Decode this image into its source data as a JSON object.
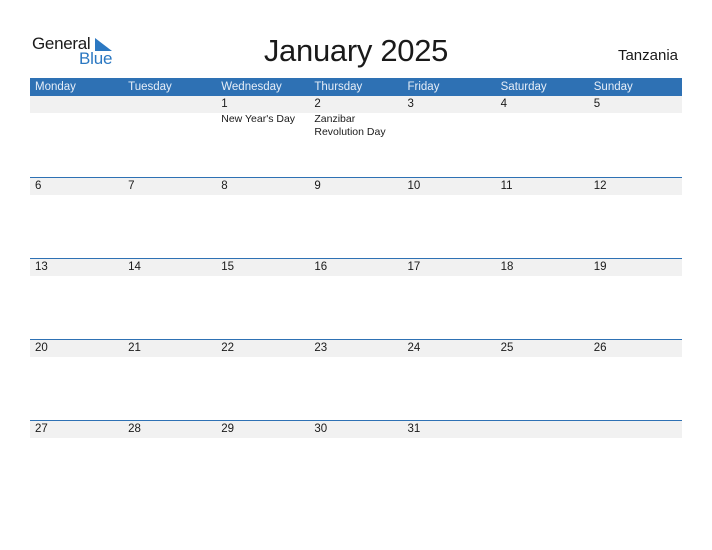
{
  "logo": {
    "word1": "General",
    "word2": "Blue",
    "icon": "triangle-flag-icon",
    "color": "#2b78c2"
  },
  "title": "January 2025",
  "country": "Tanzania",
  "colors": {
    "header_bg": "#2e71b4",
    "strip_bg": "#f1f1f1"
  },
  "weekdays": [
    "Monday",
    "Tuesday",
    "Wednesday",
    "Thursday",
    "Friday",
    "Saturday",
    "Sunday"
  ],
  "weeks": [
    [
      {
        "day": "",
        "holiday": ""
      },
      {
        "day": "",
        "holiday": ""
      },
      {
        "day": "1",
        "holiday": "New Year's Day"
      },
      {
        "day": "2",
        "holiday": "Zanzibar Revolution Day"
      },
      {
        "day": "3",
        "holiday": ""
      },
      {
        "day": "4",
        "holiday": ""
      },
      {
        "day": "5",
        "holiday": ""
      }
    ],
    [
      {
        "day": "6",
        "holiday": ""
      },
      {
        "day": "7",
        "holiday": ""
      },
      {
        "day": "8",
        "holiday": ""
      },
      {
        "day": "9",
        "holiday": ""
      },
      {
        "day": "10",
        "holiday": ""
      },
      {
        "day": "11",
        "holiday": ""
      },
      {
        "day": "12",
        "holiday": ""
      }
    ],
    [
      {
        "day": "13",
        "holiday": ""
      },
      {
        "day": "14",
        "holiday": ""
      },
      {
        "day": "15",
        "holiday": ""
      },
      {
        "day": "16",
        "holiday": ""
      },
      {
        "day": "17",
        "holiday": ""
      },
      {
        "day": "18",
        "holiday": ""
      },
      {
        "day": "19",
        "holiday": ""
      }
    ],
    [
      {
        "day": "20",
        "holiday": ""
      },
      {
        "day": "21",
        "holiday": ""
      },
      {
        "day": "22",
        "holiday": ""
      },
      {
        "day": "23",
        "holiday": ""
      },
      {
        "day": "24",
        "holiday": ""
      },
      {
        "day": "25",
        "holiday": ""
      },
      {
        "day": "26",
        "holiday": ""
      }
    ],
    [
      {
        "day": "27",
        "holiday": ""
      },
      {
        "day": "28",
        "holiday": ""
      },
      {
        "day": "29",
        "holiday": ""
      },
      {
        "day": "30",
        "holiday": ""
      },
      {
        "day": "31",
        "holiday": ""
      },
      {
        "day": "",
        "holiday": ""
      },
      {
        "day": "",
        "holiday": ""
      }
    ]
  ]
}
